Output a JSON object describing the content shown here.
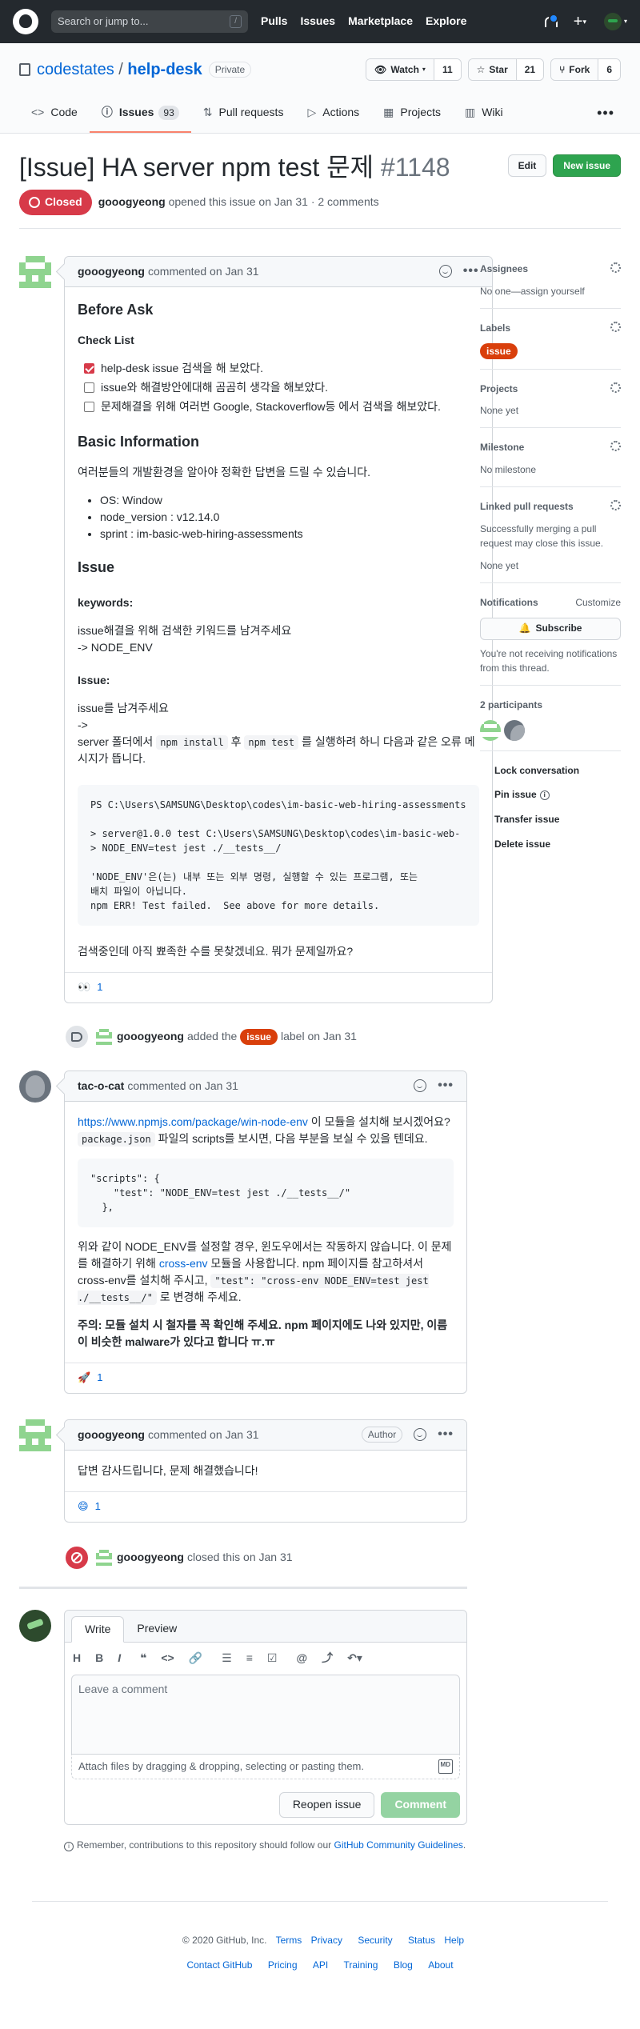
{
  "header": {
    "search_placeholder": "Search or jump to...",
    "slash": "/",
    "nav": [
      "Pulls",
      "Issues",
      "Marketplace",
      "Explore"
    ],
    "plus": "+"
  },
  "repo": {
    "owner": "codestates",
    "sep": "/",
    "name": "help-desk",
    "visibility": "Private",
    "watch_label": "Watch",
    "watch_count": "11",
    "star_label": "Star",
    "star_count": "21",
    "fork_label": "Fork",
    "fork_count": "6",
    "tabs": [
      {
        "label": "Code",
        "icon": "<>"
      },
      {
        "label": "Issues",
        "icon": "ⓘ",
        "count": "93"
      },
      {
        "label": "Pull requests",
        "icon": "⇅"
      },
      {
        "label": "Actions",
        "icon": "▷"
      },
      {
        "label": "Projects",
        "icon": "▦"
      },
      {
        "label": "Wiki",
        "icon": "▥"
      }
    ],
    "more": "•••"
  },
  "issue": {
    "title": "[Issue] HA server npm test 문제",
    "number": "#1148",
    "edit_label": "Edit",
    "new_label": "New issue",
    "state": "Closed",
    "author": "gooogyeong",
    "opened_text": "opened this issue on Jan 31 · 2 comments"
  },
  "comments": [
    {
      "author": "gooogyeong",
      "when": "commented on Jan 31",
      "before_ask": "Before Ask",
      "checklist_title": "Check List",
      "checklist": [
        {
          "text": "help-desk issue 검색을 해 보았다.",
          "checked": true
        },
        {
          "text": "issue와 해결방안에대해 곰곰히 생각을 해보았다.",
          "checked": false
        },
        {
          "text": "문제해결을 위해 여러번 Google, Stackoverflow등 에서 검색을 해보았다.",
          "checked": false
        }
      ],
      "basic_info_title": "Basic Information",
      "basic_info_intro": "여러분들의 개발환경을 알아야 정확한 답변을 드릴 수 있습니다.",
      "basic_info": [
        "OS: Window",
        "node_version : v12.14.0",
        "sprint : im-basic-web-hiring-assessments"
      ],
      "issue_title": "Issue",
      "keywords_title": "keywords:",
      "keywords_line1": "issue해결을 위해 검색한 키워드를 남겨주세요",
      "keywords_line2": "-> NODE_ENV",
      "issue_sub": "Issue:",
      "issue_line1": "issue를 남겨주세요",
      "issue_line2": "->",
      "issue_line3_a": "server 폴더에서 ",
      "issue_code1": "npm install",
      "issue_line3_b": " 후 ",
      "issue_code2": "npm test",
      "issue_line3_c": " 를 실행하려 하니 다음과 같은 오류 메시지가 뜹니다.",
      "pre": "PS C:\\Users\\SAMSUNG\\Desktop\\codes\\im-basic-web-hiring-assessments\n\n> server@1.0.0 test C:\\Users\\SAMSUNG\\Desktop\\codes\\im-basic-web-\n> NODE_ENV=test jest ./__tests__/\n\n'NODE_ENV'은(는) 내부 또는 외부 명령, 실행할 수 있는 프로그램, 또는\n배치 파일이 아닙니다.\nnpm ERR! Test failed.  See above for more details.",
      "closing": "검색중인데 아직 뾰족한 수를 못찾겠네요. 뭐가 문제일까요?",
      "reaction_emoji": "👀",
      "reaction_count": "1"
    },
    {
      "author": "tac-o-cat",
      "when": "commented on Jan 31",
      "link": "https://www.npmjs.com/package/win-node-env",
      "p1_a": " 이 모듈을 설치해 보시겠어요?",
      "p1_code": "package.json",
      "p1_b": " 파일의 scripts를 보시면, 다음 부분을 보실 수 있을 텐데요.",
      "pre": "\"scripts\": {\n    \"test\": \"NODE_ENV=test jest ./__tests__/\"\n  },",
      "p2_a": "위와 같이 NODE_ENV를 설정할 경우, 윈도우에서는 작동하지 않습니다. 이 문제를 해결하기 위해 ",
      "p2_link": "cross-env",
      "p2_b": " 모듈을 사용합니다. npm 페이지를 참고하셔서 cross-env를 설치해 주시고, ",
      "p2_code": "\"test\": \"cross-env NODE_ENV=test jest ./__tests__/\"",
      "p2_c": " 로 변경해 주세요.",
      "p3": "주의: 모듈 설치 시 철자를 꼭 확인해 주세요. npm 페이지에도 나와 있지만, 이름이 비슷한 malware가 있다고 합니다 ㅠ.ㅠ",
      "reaction_emoji": "🚀",
      "reaction_count": "1"
    },
    {
      "author": "gooogyeong",
      "when": "commented on Jan 31",
      "badge": "Author",
      "body": "답변 감사드립니다, 문제 해결했습니다!",
      "reaction_emoji": "😄",
      "reaction_count": "1"
    }
  ],
  "events": {
    "labeled_user": "gooogyeong",
    "labeled_a": "added the",
    "labeled_label": "issue",
    "labeled_b": "label on Jan 31",
    "closed_user": "gooogyeong",
    "closed_text": "closed this on Jan 31"
  },
  "composer": {
    "tab_write": "Write",
    "tab_preview": "Preview",
    "toolbar": [
      "H",
      "B",
      "I",
      "❝",
      "<>",
      "🔗",
      "☰",
      "≡",
      "☑",
      "@",
      "⤴",
      "↶▾"
    ],
    "placeholder": "Leave a comment",
    "attach": "Attach files by dragging & dropping, selecting or pasting them.",
    "md": "MD",
    "reopen": "Reopen issue",
    "comment": "Comment",
    "remember_a": "Remember, contributions to this repository should follow our ",
    "remember_link": "GitHub Community Guidelines",
    "remember_b": "."
  },
  "sidebar": {
    "assignees_h": "Assignees",
    "assignees_v": "No one—assign yourself",
    "labels_h": "Labels",
    "labels_v": "issue",
    "projects_h": "Projects",
    "projects_v": "None yet",
    "milestone_h": "Milestone",
    "milestone_v": "No milestone",
    "linked_h": "Linked pull requests",
    "linked_v": "Successfully merging a pull request may close this issue.",
    "linked_none": "None yet",
    "notif_h": "Notifications",
    "notif_customize": "Customize",
    "subscribe": "Subscribe",
    "notif_v": "You're not receiving notifications from this thread.",
    "participants_h": "2 participants",
    "lock": "Lock conversation",
    "pin": "Pin issue",
    "transfer": "Transfer issue",
    "delete": "Delete issue"
  },
  "footer": {
    "copy": "© 2020 GitHub, Inc.",
    "row1": [
      "Terms",
      "Privacy",
      "Security",
      "Status",
      "Help"
    ],
    "row2": [
      "Contact GitHub",
      "Pricing",
      "API",
      "Training",
      "Blog",
      "About"
    ]
  },
  "colors": {
    "accent": "#0366d6",
    "closed": "#d73a49",
    "label": "#d93f0b",
    "green": "#2ea44f"
  }
}
